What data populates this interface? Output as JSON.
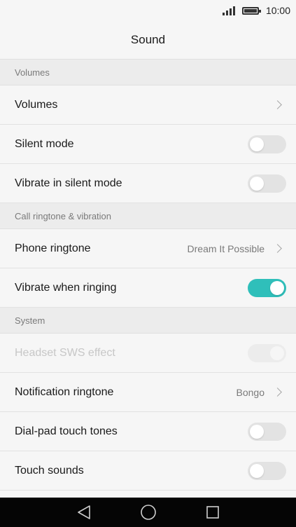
{
  "status_bar": {
    "time": "10:00",
    "signal_icon": "signal-icon",
    "battery_icon": "battery-icon"
  },
  "header": {
    "title": "Sound"
  },
  "sections": [
    {
      "header": "Volumes",
      "items": [
        {
          "label": "Volumes",
          "type": "link"
        },
        {
          "label": "Silent mode",
          "type": "toggle",
          "on": false
        },
        {
          "label": "Vibrate in silent mode",
          "type": "toggle",
          "on": false
        }
      ]
    },
    {
      "header": "Call ringtone & vibration",
      "items": [
        {
          "label": "Phone ringtone",
          "type": "link",
          "value": "Dream It Possible"
        },
        {
          "label": "Vibrate when ringing",
          "type": "toggle",
          "on": true
        }
      ]
    },
    {
      "header": "System",
      "items": [
        {
          "label": "Headset SWS effect",
          "type": "toggle",
          "on": true,
          "disabled": true
        },
        {
          "label": "Notification ringtone",
          "type": "link",
          "value": "Bongo"
        },
        {
          "label": "Dial-pad touch tones",
          "type": "toggle",
          "on": false
        },
        {
          "label": "Touch sounds",
          "type": "toggle",
          "on": false
        }
      ]
    }
  ],
  "colors": {
    "accent": "#2fbfba",
    "background": "#f6f6f6",
    "section_background": "#ececec",
    "nav_bar": "#050505"
  },
  "nav_bar": {
    "back_icon": "back-triangle-icon",
    "home_icon": "home-circle-icon",
    "recent_icon": "recent-square-icon"
  }
}
